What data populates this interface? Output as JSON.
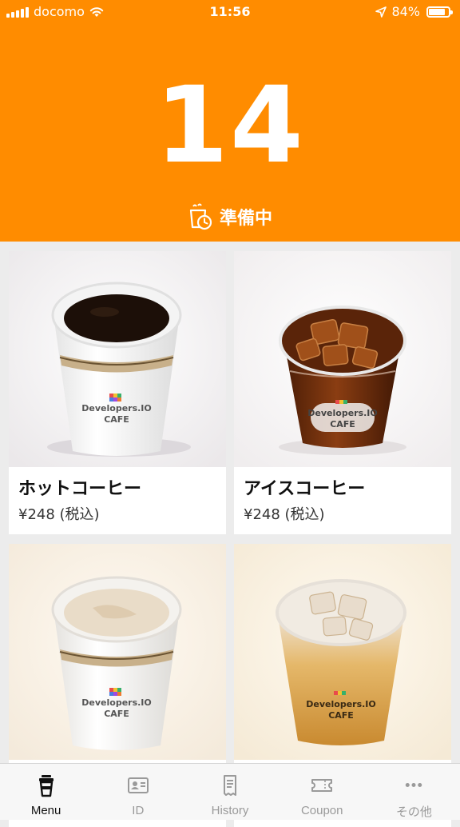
{
  "status_bar": {
    "carrier": "docomo",
    "time": "11:56",
    "battery": "84%",
    "battery_level": 0.84
  },
  "header": {
    "order_number": "14",
    "status": "準備中",
    "background_color": "#ff8c00"
  },
  "menu": {
    "items": [
      {
        "name": "ホットコーヒー",
        "price": "¥248 (税込)",
        "photo": "hot-coffee"
      },
      {
        "name": "アイスコーヒー",
        "price": "¥248 (税込)",
        "photo": "iced-coffee"
      },
      {
        "name": "",
        "price": "",
        "photo": "hot-latte"
      },
      {
        "name": "",
        "price": "",
        "photo": "iced-latte"
      }
    ]
  },
  "cup_label": {
    "line1": "Developers.IO",
    "line2": "CAFE"
  },
  "tabbar": {
    "tabs": [
      {
        "label": "Menu",
        "icon": "cup-icon",
        "active": true
      },
      {
        "label": "ID",
        "icon": "id-card-icon",
        "active": false
      },
      {
        "label": "History",
        "icon": "receipt-icon",
        "active": false
      },
      {
        "label": "Coupon",
        "icon": "ticket-icon",
        "active": false
      },
      {
        "label": "その他",
        "icon": "more-icon",
        "active": false
      }
    ]
  }
}
